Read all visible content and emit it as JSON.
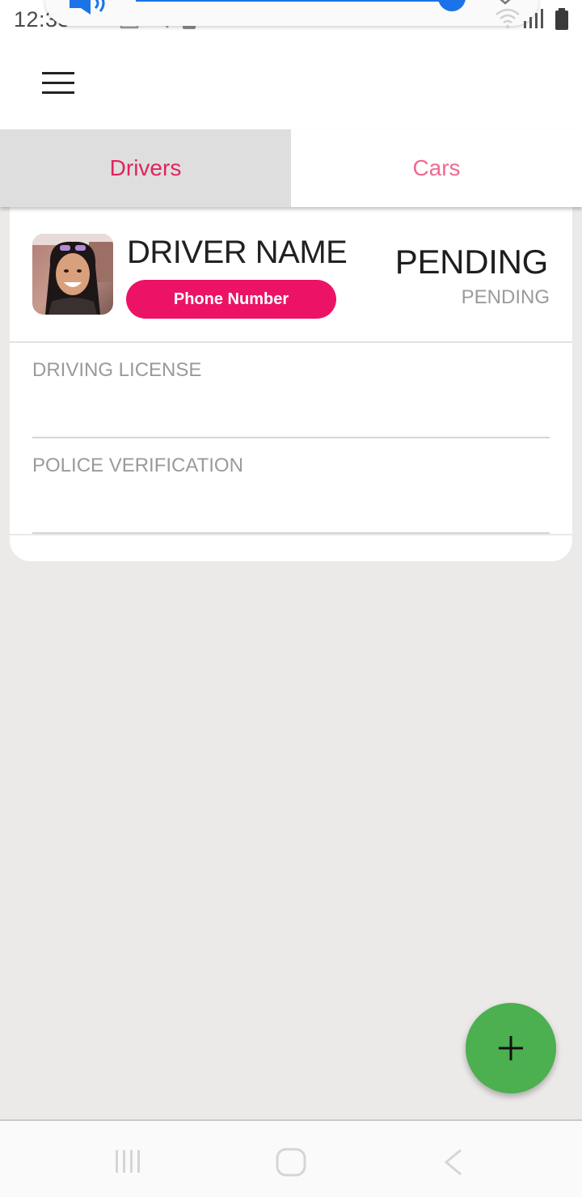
{
  "status_bar": {
    "time": "12:33",
    "icons": [
      "volume-icon",
      "youtube-icon",
      "sim-icon",
      "magic-icon",
      "battery-saver-icon",
      "chevron-down-icon",
      "wifi-icon",
      "signal-icon",
      "battery-icon"
    ],
    "accent_color": "#1a73e8"
  },
  "app_bar": {
    "menu_icon": "hamburger-menu-icon"
  },
  "tabs": [
    {
      "label": "Drivers",
      "active": true
    },
    {
      "label": "Cars",
      "active": false
    }
  ],
  "driver_card": {
    "name": "DRIVER NAME",
    "phone_label": "Phone Number",
    "status_primary": "PENDING",
    "status_secondary": "PENDING",
    "documents": [
      {
        "label": "DRIVING LICENSE"
      },
      {
        "label": "POLICE VERIFICATION"
      }
    ]
  },
  "fab": {
    "icon": "plus-icon",
    "color": "#4caf50"
  },
  "nav_bar": {
    "icons": [
      "recent-apps-icon",
      "home-icon",
      "back-icon"
    ]
  },
  "colors": {
    "accent": "#ec1366",
    "tab_active_text": "#e0245e",
    "tab_inactive_text": "#ef6a92",
    "background": "#eceae8"
  }
}
